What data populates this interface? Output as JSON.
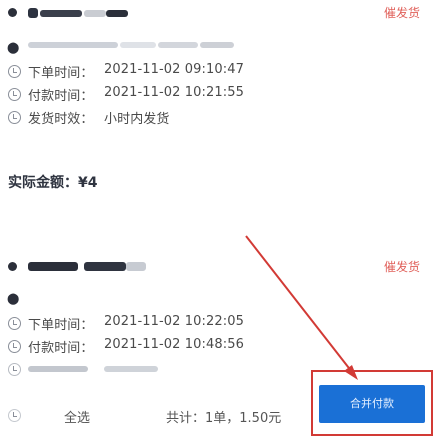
{
  "order1": {
    "action": "催发货",
    "line3_label": "下单时间：",
    "line3_value": "2021-11-02 09:10:47",
    "line4_label": "付款时间：",
    "line4_value": "2021-11-02 10:21:55",
    "line5_label": "发货时效：",
    "line5_value": "小时内发货"
  },
  "amount": {
    "text": "实际金额：¥4"
  },
  "order2": {
    "action": "催发货",
    "line3_label": "下单时间：",
    "line3_value": "2021-11-02 10:22:05",
    "line4_label": "付款时间：",
    "line4_value": "2021-11-02 10:48:56"
  },
  "footer": {
    "select_all": "全选",
    "total_text": "共计：1单，1.50元",
    "button_label": "合并付款"
  },
  "colors": {
    "accent_red": "#e0605a",
    "highlight_border": "#d23a35",
    "primary_blue": "#1a70d6"
  }
}
